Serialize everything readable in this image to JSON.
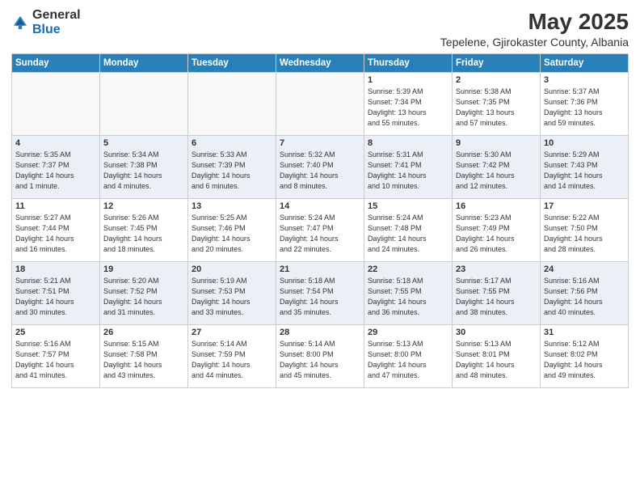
{
  "header": {
    "logo_general": "General",
    "logo_blue": "Blue",
    "title": "May 2025",
    "subtitle": "Tepelene, Gjirokaster County, Albania"
  },
  "columns": [
    "Sunday",
    "Monday",
    "Tuesday",
    "Wednesday",
    "Thursday",
    "Friday",
    "Saturday"
  ],
  "weeks": [
    [
      {
        "day": "",
        "info": ""
      },
      {
        "day": "",
        "info": ""
      },
      {
        "day": "",
        "info": ""
      },
      {
        "day": "",
        "info": ""
      },
      {
        "day": "1",
        "info": "Sunrise: 5:39 AM\nSunset: 7:34 PM\nDaylight: 13 hours\nand 55 minutes."
      },
      {
        "day": "2",
        "info": "Sunrise: 5:38 AM\nSunset: 7:35 PM\nDaylight: 13 hours\nand 57 minutes."
      },
      {
        "day": "3",
        "info": "Sunrise: 5:37 AM\nSunset: 7:36 PM\nDaylight: 13 hours\nand 59 minutes."
      }
    ],
    [
      {
        "day": "4",
        "info": "Sunrise: 5:35 AM\nSunset: 7:37 PM\nDaylight: 14 hours\nand 1 minute."
      },
      {
        "day": "5",
        "info": "Sunrise: 5:34 AM\nSunset: 7:38 PM\nDaylight: 14 hours\nand 4 minutes."
      },
      {
        "day": "6",
        "info": "Sunrise: 5:33 AM\nSunset: 7:39 PM\nDaylight: 14 hours\nand 6 minutes."
      },
      {
        "day": "7",
        "info": "Sunrise: 5:32 AM\nSunset: 7:40 PM\nDaylight: 14 hours\nand 8 minutes."
      },
      {
        "day": "8",
        "info": "Sunrise: 5:31 AM\nSunset: 7:41 PM\nDaylight: 14 hours\nand 10 minutes."
      },
      {
        "day": "9",
        "info": "Sunrise: 5:30 AM\nSunset: 7:42 PM\nDaylight: 14 hours\nand 12 minutes."
      },
      {
        "day": "10",
        "info": "Sunrise: 5:29 AM\nSunset: 7:43 PM\nDaylight: 14 hours\nand 14 minutes."
      }
    ],
    [
      {
        "day": "11",
        "info": "Sunrise: 5:27 AM\nSunset: 7:44 PM\nDaylight: 14 hours\nand 16 minutes."
      },
      {
        "day": "12",
        "info": "Sunrise: 5:26 AM\nSunset: 7:45 PM\nDaylight: 14 hours\nand 18 minutes."
      },
      {
        "day": "13",
        "info": "Sunrise: 5:25 AM\nSunset: 7:46 PM\nDaylight: 14 hours\nand 20 minutes."
      },
      {
        "day": "14",
        "info": "Sunrise: 5:24 AM\nSunset: 7:47 PM\nDaylight: 14 hours\nand 22 minutes."
      },
      {
        "day": "15",
        "info": "Sunrise: 5:24 AM\nSunset: 7:48 PM\nDaylight: 14 hours\nand 24 minutes."
      },
      {
        "day": "16",
        "info": "Sunrise: 5:23 AM\nSunset: 7:49 PM\nDaylight: 14 hours\nand 26 minutes."
      },
      {
        "day": "17",
        "info": "Sunrise: 5:22 AM\nSunset: 7:50 PM\nDaylight: 14 hours\nand 28 minutes."
      }
    ],
    [
      {
        "day": "18",
        "info": "Sunrise: 5:21 AM\nSunset: 7:51 PM\nDaylight: 14 hours\nand 30 minutes."
      },
      {
        "day": "19",
        "info": "Sunrise: 5:20 AM\nSunset: 7:52 PM\nDaylight: 14 hours\nand 31 minutes."
      },
      {
        "day": "20",
        "info": "Sunrise: 5:19 AM\nSunset: 7:53 PM\nDaylight: 14 hours\nand 33 minutes."
      },
      {
        "day": "21",
        "info": "Sunrise: 5:18 AM\nSunset: 7:54 PM\nDaylight: 14 hours\nand 35 minutes."
      },
      {
        "day": "22",
        "info": "Sunrise: 5:18 AM\nSunset: 7:55 PM\nDaylight: 14 hours\nand 36 minutes."
      },
      {
        "day": "23",
        "info": "Sunrise: 5:17 AM\nSunset: 7:55 PM\nDaylight: 14 hours\nand 38 minutes."
      },
      {
        "day": "24",
        "info": "Sunrise: 5:16 AM\nSunset: 7:56 PM\nDaylight: 14 hours\nand 40 minutes."
      }
    ],
    [
      {
        "day": "25",
        "info": "Sunrise: 5:16 AM\nSunset: 7:57 PM\nDaylight: 14 hours\nand 41 minutes."
      },
      {
        "day": "26",
        "info": "Sunrise: 5:15 AM\nSunset: 7:58 PM\nDaylight: 14 hours\nand 43 minutes."
      },
      {
        "day": "27",
        "info": "Sunrise: 5:14 AM\nSunset: 7:59 PM\nDaylight: 14 hours\nand 44 minutes."
      },
      {
        "day": "28",
        "info": "Sunrise: 5:14 AM\nSunset: 8:00 PM\nDaylight: 14 hours\nand 45 minutes."
      },
      {
        "day": "29",
        "info": "Sunrise: 5:13 AM\nSunset: 8:00 PM\nDaylight: 14 hours\nand 47 minutes."
      },
      {
        "day": "30",
        "info": "Sunrise: 5:13 AM\nSunset: 8:01 PM\nDaylight: 14 hours\nand 48 minutes."
      },
      {
        "day": "31",
        "info": "Sunrise: 5:12 AM\nSunset: 8:02 PM\nDaylight: 14 hours\nand 49 minutes."
      }
    ]
  ]
}
